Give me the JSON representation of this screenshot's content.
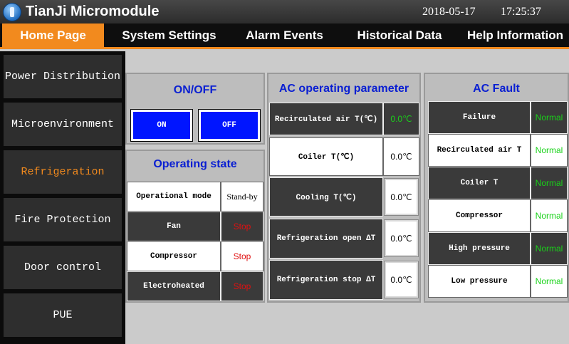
{
  "header": {
    "title": "TianJi Micromodule",
    "date": "2018-05-17",
    "time": "17:25:37"
  },
  "nav": {
    "tabs": [
      {
        "label": "Home Page",
        "active": true
      },
      {
        "label": "System Settings",
        "active": false
      },
      {
        "label": "Alarm Events",
        "active": false
      },
      {
        "label": "Historical Data",
        "active": false
      },
      {
        "label": "Help Information",
        "active": false
      }
    ]
  },
  "sidebar": {
    "items": [
      {
        "label": "Power Distribution",
        "active": false
      },
      {
        "label": "Microenvironment",
        "active": false
      },
      {
        "label": "Refrigeration",
        "active": true
      },
      {
        "label": "Fire Protection",
        "active": false
      },
      {
        "label": "Door control",
        "active": false
      },
      {
        "label": "PUE",
        "active": false
      }
    ]
  },
  "onoff": {
    "title": "ON/OFF",
    "on_label": "ON",
    "off_label": "OFF"
  },
  "operating_state": {
    "title": "Operating state",
    "rows": [
      {
        "label": "Operational mode",
        "value": "Stand-by"
      },
      {
        "label": "Fan",
        "value": "Stop"
      },
      {
        "label": "Compressor",
        "value": "Stop"
      },
      {
        "label": "Electroheated",
        "value": "Stop"
      }
    ]
  },
  "ac_params": {
    "title": "AC operating parameter",
    "rows": [
      {
        "label": "Recirculated air T(℃)",
        "value": "0.0℃"
      },
      {
        "label": "Coiler T(℃)",
        "value": "0.0℃"
      },
      {
        "label": "Cooling T(℃)",
        "value": "0.0℃"
      },
      {
        "label": "Refrigeration open ΔT",
        "value": "0.0℃"
      },
      {
        "label": "Refrigeration stop ΔT",
        "value": "0.0℃"
      }
    ]
  },
  "ac_fault": {
    "title": "AC Fault",
    "rows": [
      {
        "label": "Failure",
        "value": "Normal"
      },
      {
        "label": "Recirculated air T",
        "value": "Normal"
      },
      {
        "label": "Coiler T",
        "value": "Normal"
      },
      {
        "label": "Compressor",
        "value": "Normal"
      },
      {
        "label": "High pressure",
        "value": "Normal"
      },
      {
        "label": "Low pressure",
        "value": "Normal"
      }
    ]
  },
  "colors": {
    "accent_orange": "#f28a1e",
    "title_blue": "#0a1fd2",
    "button_blue": "#0015ff",
    "normal_green": "#19d219",
    "stop_red": "#e01010"
  }
}
